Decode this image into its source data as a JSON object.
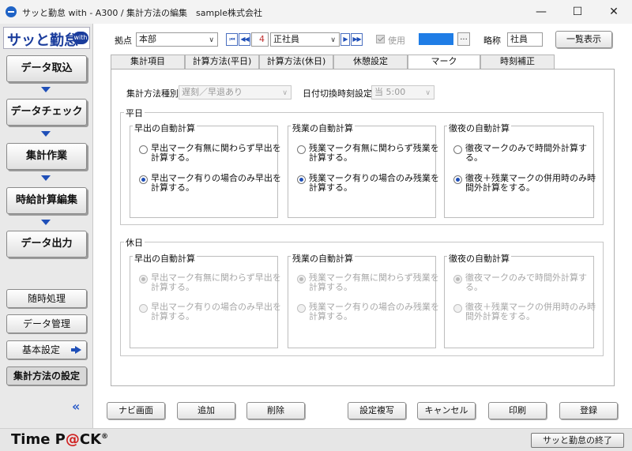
{
  "window": {
    "title": "サッと勤怠 with - A300 / 集計方法の編集　sample株式会社",
    "minimize": "—",
    "maximize": "☐",
    "close": "✕"
  },
  "sidebar": {
    "logo": "サッと勤怠",
    "logo_badge": "with",
    "main_buttons": [
      "データ取込",
      "データチェック",
      "集計作業",
      "時給計算編集",
      "データ出力"
    ],
    "sub_buttons": [
      "随時処理",
      "データ管理",
      "基本設定",
      "集計方法の設定"
    ],
    "collapse": "«"
  },
  "header": {
    "base_label": "拠点",
    "base_value": "本部",
    "first": "⏮",
    "prev": "◀◀",
    "number": "4",
    "employment_value": "正社員",
    "next": "▶",
    "last": "▶▶",
    "use_label": "使用",
    "ellipsis": "...",
    "abbr_label": "略称",
    "abbr_value": "社員",
    "list_button": "一覧表示"
  },
  "tabs": [
    "集計項目",
    "計算方法(平日)",
    "計算方法(休日)",
    "休憩設定",
    "マーク",
    "時刻補正"
  ],
  "active_tab": 4,
  "panel": {
    "method_label": "集計方法種別",
    "method_value": "遅刻／早退あり",
    "switch_label": "日付切換時刻設定",
    "switch_value": "当 5:00",
    "weekday": {
      "title": "平日",
      "early": {
        "title": "早出の自動計算",
        "opt1": "早出マーク有無に関わらず早出を計算する。",
        "opt2": "早出マーク有りの場合のみ早出を計算する。"
      },
      "overtime": {
        "title": "残業の自動計算",
        "opt1": "残業マーク有無に関わらず残業を計算する。",
        "opt2": "残業マーク有りの場合のみ残業を計算する。"
      },
      "allnight": {
        "title": "徹夜の自動計算",
        "opt1": "徹夜マークのみで時間外計算する。",
        "opt2": "徹夜＋残業マークの併用時のみ時間外計算をする。"
      }
    },
    "holiday": {
      "title": "休日",
      "early": {
        "title": "早出の自動計算",
        "opt1": "早出マーク有無に関わらず早出を計算する。",
        "opt2": "早出マーク有りの場合のみ早出を計算する。"
      },
      "overtime": {
        "title": "残業の自動計算",
        "opt1": "残業マーク有無に関わらず残業を計算する。",
        "opt2": "残業マーク有りの場合のみ残業を計算する。"
      },
      "allnight": {
        "title": "徹夜の自動計算",
        "opt1": "徹夜マークのみで時間外計算する。",
        "opt2": "徹夜＋残業マークの併用時のみ時間外計算をする。"
      }
    }
  },
  "actions": [
    "ナビ画面",
    "追加",
    "削除",
    "設定複写",
    "キャンセル",
    "印刷",
    "登録"
  ],
  "footer": {
    "brand_a": "Time P",
    "brand_at": "@",
    "brand_b": "CK",
    "brand_reg": "®",
    "exit_button": "サッと勤怠の終了"
  },
  "colors": {
    "swatch": "#1f7de6",
    "accent": "#1f4fb8"
  }
}
